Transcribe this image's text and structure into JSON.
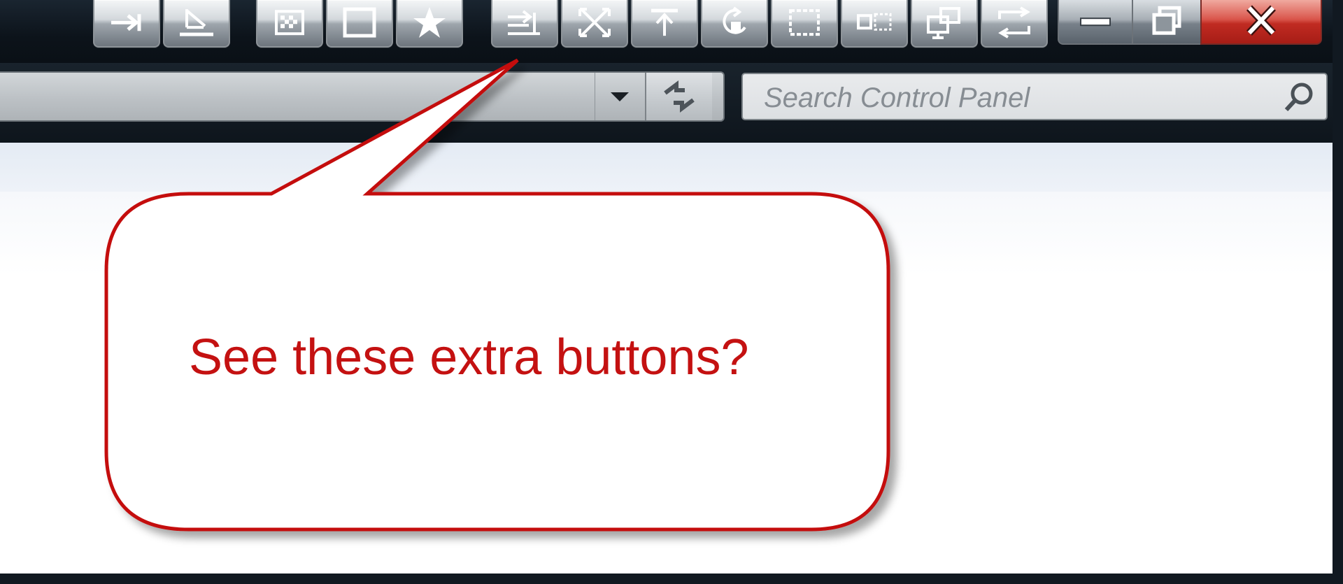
{
  "toolbar": {
    "buttons": [
      {
        "icon": "pin-arrow-icon"
      },
      {
        "icon": "send-to-back-icon"
      },
      {
        "icon": "transparency-icon"
      },
      {
        "icon": "resize-window-icon"
      },
      {
        "icon": "favorite-star-icon"
      },
      {
        "icon": "align-window-icon"
      },
      {
        "icon": "expand-window-icon"
      },
      {
        "icon": "always-on-top-icon"
      },
      {
        "icon": "roll-up-icon"
      },
      {
        "icon": "minimize-to-tray-icon"
      },
      {
        "icon": "small-window-icon"
      },
      {
        "icon": "move-to-monitor-icon"
      },
      {
        "icon": "copy-window-icon"
      }
    ],
    "window_controls": [
      "minimize-icon",
      "restore-icon",
      "close-icon"
    ]
  },
  "address_bar": {
    "value": ""
  },
  "search": {
    "placeholder": "Search Control Panel"
  },
  "callout": {
    "text": "See these extra buttons?",
    "color": "#c41111"
  },
  "colors": {
    "frame": "#0d141b",
    "close_button": "#c02b22",
    "content_stripe": "#e8eef6"
  }
}
